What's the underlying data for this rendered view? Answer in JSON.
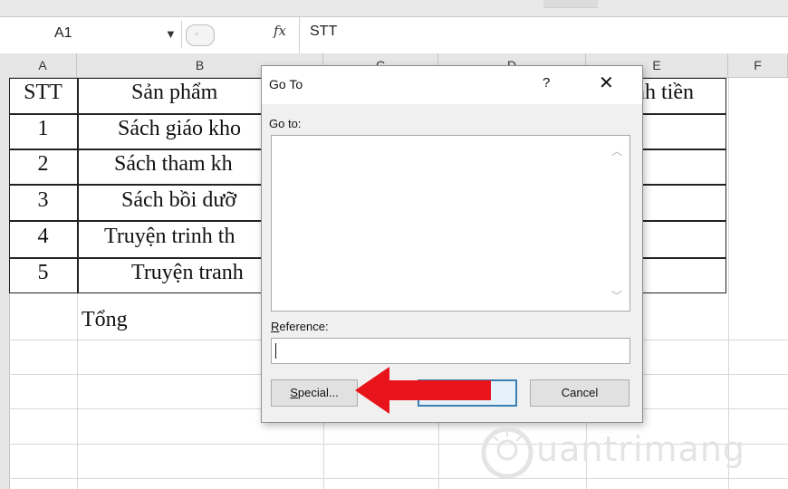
{
  "formula_bar": {
    "name_box": "A1",
    "fx_label": "fx",
    "formula_value": "STT"
  },
  "columns": [
    "A",
    "B",
    "C",
    "D",
    "E",
    "F"
  ],
  "table": {
    "header_stt": "STT",
    "header_product": "Sản phẩm",
    "header_amount": "nh tiền",
    "stt": [
      "1",
      "2",
      "3",
      "4",
      "5"
    ],
    "products": [
      "Sách giáo kho",
      "Sách tham kh",
      "Sách bồi dưỡ",
      "Truyện trinh th",
      "Truyện tranh"
    ],
    "total_label": "Tổng"
  },
  "dialog": {
    "title": "Go To",
    "help": "?",
    "close": "✕",
    "goto_label": "Go to:",
    "reference_label": "Reference:",
    "reference_value": "",
    "special_button": "Special...",
    "ok_button": "",
    "cancel_button": "Cancel"
  },
  "colors": {
    "arrow": "#e8141b",
    "header_bg": "#e6e6e6",
    "dialog_bg": "#f0f0f0"
  }
}
